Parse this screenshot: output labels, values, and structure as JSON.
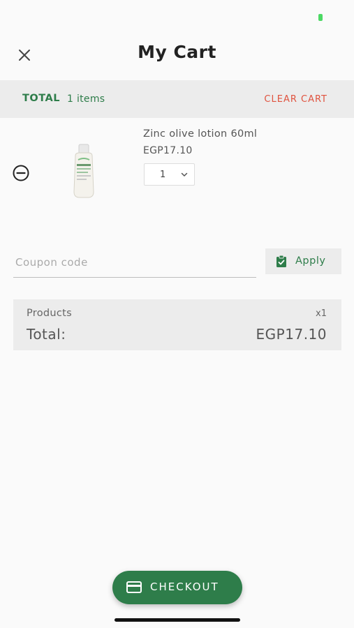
{
  "header": {
    "title": "My Cart",
    "close_icon": "close-icon"
  },
  "summary_bar": {
    "total_label": "TOTAL",
    "item_count": "1 items",
    "clear_label": "CLEAR CART"
  },
  "cart": {
    "items": [
      {
        "name": "Zinc olive lotion 60ml",
        "price": "EGP17.10",
        "quantity": "1",
        "image_icon": "lotion-bottle-image",
        "remove_icon": "minus-circle-icon"
      }
    ]
  },
  "coupon": {
    "placeholder": "Coupon code",
    "value": "",
    "apply_label": "Apply",
    "apply_icon": "clipboard-check-icon"
  },
  "order_summary": {
    "products_label": "Products",
    "products_count": "x1",
    "total_label": "Total:",
    "total_value": "EGP17.10"
  },
  "checkout": {
    "label": "CHECKOUT",
    "icon": "credit-card-icon"
  },
  "colors": {
    "accent": "#2e7d4a",
    "danger": "#e0533f",
    "panel": "#ececec",
    "background": "#fafafa"
  }
}
